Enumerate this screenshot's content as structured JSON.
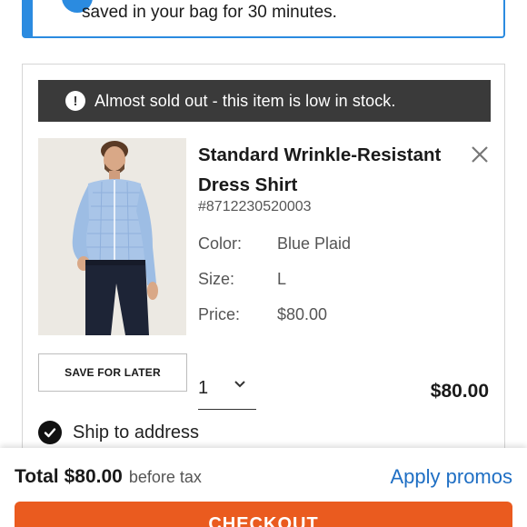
{
  "banner": {
    "text": "saved in your bag for 30 minutes.",
    "icon": "info-icon",
    "accent_color": "#2b8be0"
  },
  "alert": {
    "text": "Almost sold out - this item is low in stock.",
    "icon": "exclamation-icon"
  },
  "product": {
    "title": "Standard Wrinkle-Resistant Dress Shirt",
    "sku": "#8712230520003",
    "attributes": [
      {
        "label": "Color:",
        "value": "Blue Plaid"
      },
      {
        "label": "Size:",
        "value": "L"
      },
      {
        "label": "Price:",
        "value": "$80.00"
      }
    ],
    "save_for_later_label": "SAVE FOR LATER",
    "quantity": "1",
    "line_total": "$80.00",
    "shipping_option": "Ship to address"
  },
  "footer": {
    "total_label": "Total",
    "total_amount": "$80.00",
    "before_tax": "before tax",
    "apply_promos": "Apply promos",
    "checkout_label": "CHECKOUT",
    "checkout_color": "#ea5b1f",
    "link_color": "#1f6fc4"
  }
}
